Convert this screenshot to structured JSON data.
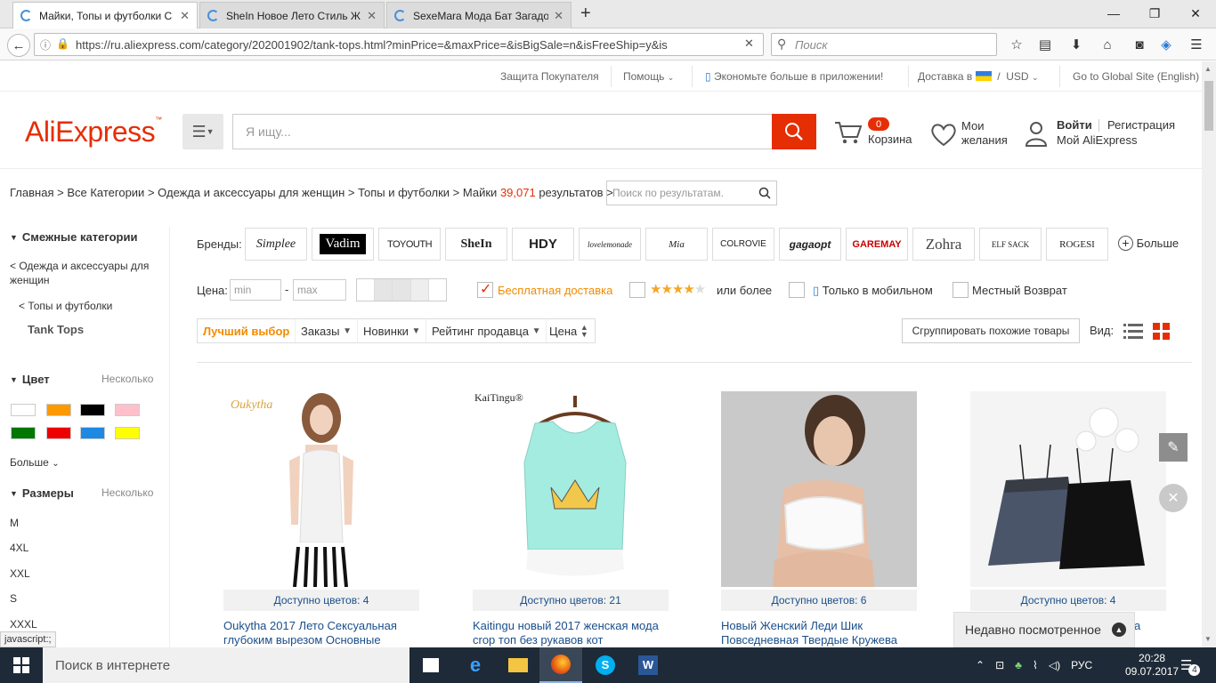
{
  "browser": {
    "tabs": [
      {
        "title": "Майки, Топы и футболки С"
      },
      {
        "title": "SheIn Новое Лето Стиль Ж"
      },
      {
        "title": "SexeMara Мода Бат Загадо"
      }
    ],
    "url": "https://ru.aliexpress.com/category/202001902/tank-tops.html?minPrice=&maxPrice=&isBigSale=n&isFreeShip=y&is",
    "search_placeholder": "Поиск"
  },
  "topstrip": {
    "protection": "Защита Покупателя",
    "help": "Помощь",
    "app": "Экономьте больше в приложении!",
    "delivery": "Доставка в",
    "currency": "USD",
    "global": "Go to Global Site (English)"
  },
  "header": {
    "logo": "AliExpress",
    "search_placeholder": "Я ищу...",
    "cart_count": "0",
    "cart_label": "Корзина",
    "wishlist_line1": "Мои",
    "wishlist_line2": "желания",
    "login": "Войти",
    "register": "Регистрация",
    "my_account": "Мой AliExpress"
  },
  "breadcrumb": {
    "items": [
      "Главная",
      "Все Категории",
      "Одежда и аксессуары для женщин",
      "Топы и футболки"
    ],
    "current": "Майки",
    "count": "39,071",
    "results": "результатов",
    "search_placeholder": "Поиск по результатам."
  },
  "sidebar": {
    "related_title": "Смежные категории",
    "parent1": "< Одежда и аксессуары для женщин",
    "parent2": "< Топы и футболки",
    "current": "Tank Tops",
    "color_title": "Цвет",
    "multiple": "Несколько",
    "more": "Больше",
    "sizes_title": "Размеры",
    "sizes": [
      "M",
      "4XL",
      "XXL",
      "S",
      "XXXL"
    ],
    "swatches": [
      "#ffffff",
      "#ff9900",
      "#000000",
      "#ffc0cb",
      "#007700",
      "#ee0000",
      "#1e88e5",
      "#ffff00"
    ]
  },
  "filters": {
    "brands_label": "Бренды:",
    "brands": [
      "Simplee",
      "Vadim",
      "TOYOUTH",
      "SheIn",
      "HDY",
      "lovelemonade",
      "Mia",
      "COLROVIE",
      "gagaopt",
      "GAREMAY",
      "Zohra",
      "ELF SACK",
      "ROGESI"
    ],
    "brands_more": "Больше",
    "price_label": "Цена:",
    "min": "min",
    "max": "max",
    "free_shipping": "Бесплатная доставка",
    "rating_suffix": "или более",
    "mobile_only": "Только в мобильном",
    "local_return": "Местный Возврат"
  },
  "sort": {
    "best": "Лучший выбор",
    "orders": "Заказы",
    "new": "Новинки",
    "seller_rating": "Рейтинг продавца",
    "price": "Цена",
    "group": "Сгруппировать похожие товары",
    "view": "Вид:"
  },
  "products": [
    {
      "brand_mark": "Oukytha",
      "colors": "Доступно цветов: 4",
      "title": "Oukytha 2017 Лето Сексуальная глубоким вырезом Основные"
    },
    {
      "brand_mark": "KaiTingu®",
      "colors": "Доступно цветов: 21",
      "title": "Kaitingu новый 2017 женская мода crop топ без рукавов кот"
    },
    {
      "brand_mark": "",
      "colors": "Доступно цветов: 6",
      "title": "Новый Женский Леди Шик Повседневная Твердые Кружева"
    },
    {
      "brand_mark": "",
      "colors": "Доступно цветов: 4",
      "title": "ева"
    }
  ],
  "recently_viewed": "Недавно посмотренное",
  "status_text": "javascript:;",
  "taskbar": {
    "search": "Поиск в интернете",
    "lang": "РУС",
    "time": "20:28",
    "date": "09.07.2017",
    "notifications": "4"
  },
  "colors": {
    "accent": "#e62e04",
    "link": "#1a4f8b",
    "sort_active": "#f28b00"
  }
}
